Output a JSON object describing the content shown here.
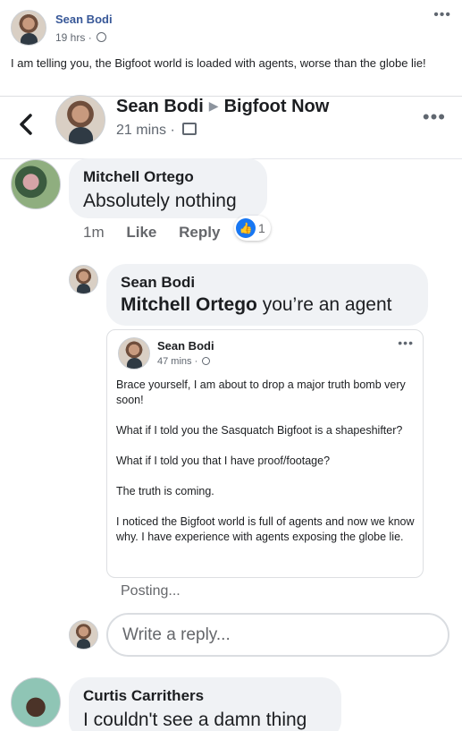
{
  "outer_post": {
    "author": "Sean Bodi",
    "time": "19 hrs",
    "text": "I am telling you, the Bigfoot world is loaded with agents, worse than the globe lie!"
  },
  "header": {
    "author": "Sean Bodi",
    "group": "Bigfoot Now",
    "time": "21 mins"
  },
  "comments": [
    {
      "author": "Mitchell Ortego",
      "text": "Absolutely nothing",
      "time": "1m",
      "like_label": "Like",
      "reply_label": "Reply",
      "reaction_count": "1"
    }
  ],
  "reply": {
    "author": "Sean Bodi",
    "mention": "Mitchell Ortego",
    "text": " you’re an agent"
  },
  "shared_post": {
    "author": "Sean Bodi",
    "time": "47 mins",
    "paragraphs": [
      "Brace yourself, I am about to drop a major truth bomb very soon!",
      "What if I told you the Sasquatch Bigfoot is a shapeshifter?",
      "What if I told you that I have proof/footage?",
      "The truth is coming.",
      "I noticed the Bigfoot world is full of agents and now we know why. I have experience with agents exposing the globe lie."
    ]
  },
  "posting_label": "Posting...",
  "reply_input": {
    "placeholder": "Write a reply..."
  },
  "last_comment": {
    "author": "Curtis Carrithers",
    "text": "I couldn't see a damn thing"
  },
  "colors": {
    "link_blue": "#385898",
    "like_blue": "#1877f2",
    "bubble_gray": "#f0f2f5"
  }
}
